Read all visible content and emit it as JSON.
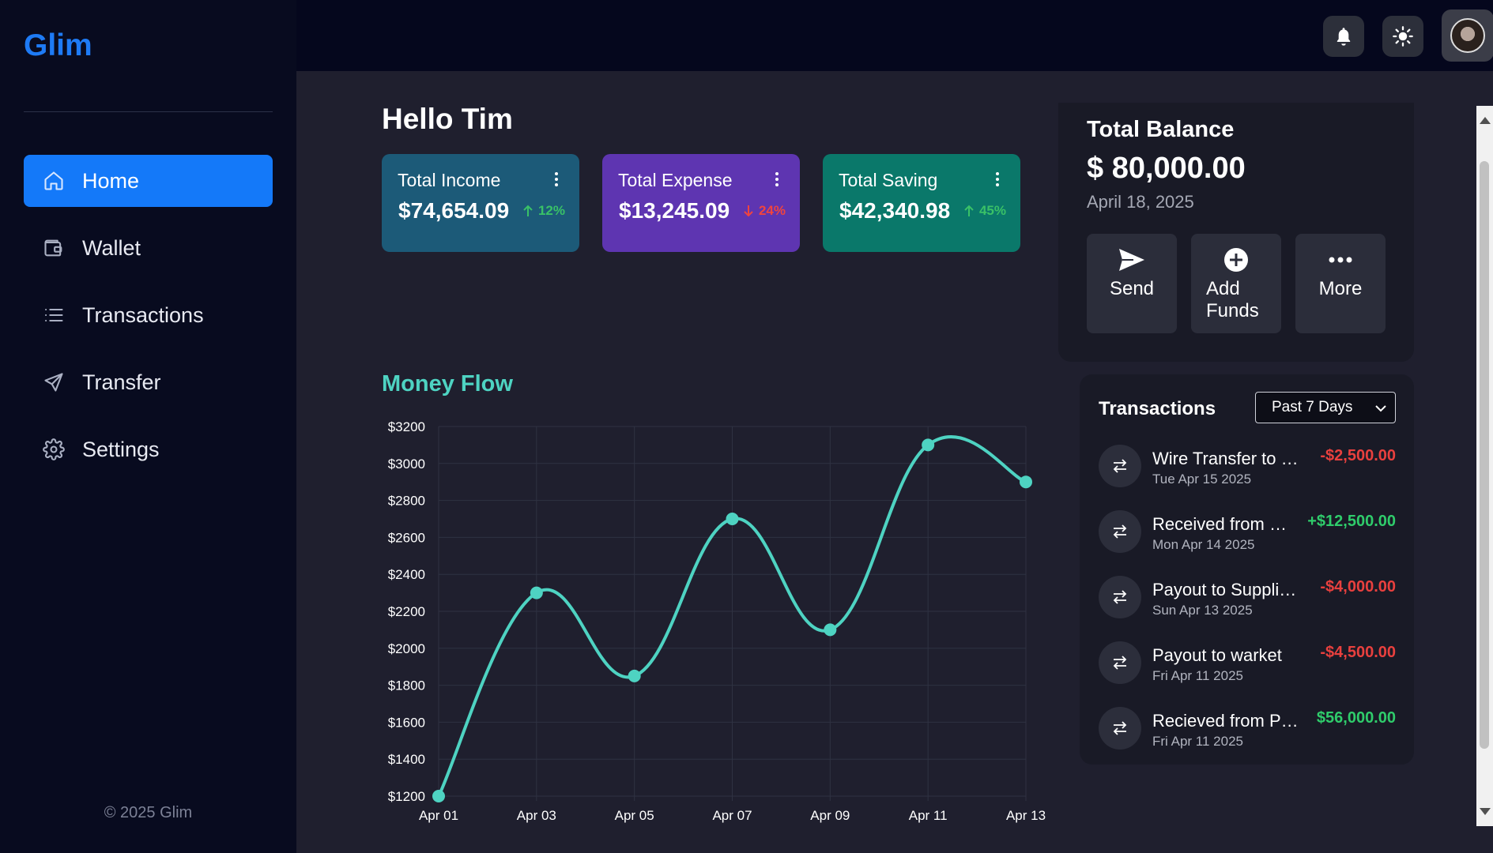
{
  "app": {
    "logo": "Glim",
    "copyright": "© 2025 Glim"
  },
  "sidebar": {
    "items": [
      {
        "label": "Home",
        "icon": "home-icon",
        "active": true
      },
      {
        "label": "Wallet",
        "icon": "wallet-icon",
        "active": false
      },
      {
        "label": "Transactions",
        "icon": "list-icon",
        "active": false
      },
      {
        "label": "Transfer",
        "icon": "send-icon",
        "active": false
      },
      {
        "label": "Settings",
        "icon": "gear-icon",
        "active": false
      }
    ]
  },
  "header": {
    "icons": [
      "bell-icon",
      "sun-icon",
      "avatar"
    ]
  },
  "main": {
    "greeting": "Hello Tim",
    "cards": [
      {
        "title": "Total Income",
        "value": "$74,654.09",
        "change": "12%",
        "direction": "up",
        "color": "#1c5a78"
      },
      {
        "title": "Total Expense",
        "value": "$13,245.09",
        "change": "24%",
        "direction": "down",
        "color": "#5e35b1"
      },
      {
        "title": "Total Saving",
        "value": "$42,340.98",
        "change": "45%",
        "direction": "up",
        "color": "#0a786a"
      }
    ],
    "money_flow_title": "Money Flow"
  },
  "balance": {
    "title": "Total Balance",
    "value": "$ 80,000.00",
    "date": "April 18, 2025",
    "actions": [
      {
        "label": "Send",
        "icon": "send-icon"
      },
      {
        "label": "Add Funds",
        "icon": "plus-circle-icon"
      },
      {
        "label": "More",
        "icon": "more-icon"
      }
    ]
  },
  "transactions": {
    "title": "Transactions",
    "filter": "Past 7 Days",
    "items": [
      {
        "name": "Wire Transfer to …",
        "date": "Tue Apr 15 2025",
        "amount": "-$2,500.00",
        "type": "neg"
      },
      {
        "name": "Received from …",
        "date": "Mon Apr 14 2025",
        "amount": "+$12,500.00",
        "type": "pos"
      },
      {
        "name": "Payout to Supplie…",
        "date": "Sun Apr 13 2025",
        "amount": "-$4,000.00",
        "type": "neg"
      },
      {
        "name": "Payout to warket",
        "date": "Fri Apr 11 2025",
        "amount": "-$4,500.00",
        "type": "neg"
      },
      {
        "name": "Recieved from P…",
        "date": "Fri Apr 11 2025",
        "amount": "$56,000.00",
        "type": "pos"
      }
    ]
  },
  "chart_data": {
    "type": "line",
    "categories": [
      "Apr 01",
      "Apr 03",
      "Apr 05",
      "Apr 07",
      "Apr 09",
      "Apr 11",
      "Apr 13"
    ],
    "values": [
      1200,
      2300,
      1850,
      2700,
      2100,
      3100,
      2900
    ],
    "yticks": [
      "$1200",
      "$1400",
      "$1600",
      "$1800",
      "$2000",
      "$2200",
      "$2400",
      "$2600",
      "$2800",
      "$3000",
      "$3200"
    ],
    "ylim": [
      1200,
      3200
    ],
    "line_color": "#4ed3c2",
    "grid": true
  }
}
